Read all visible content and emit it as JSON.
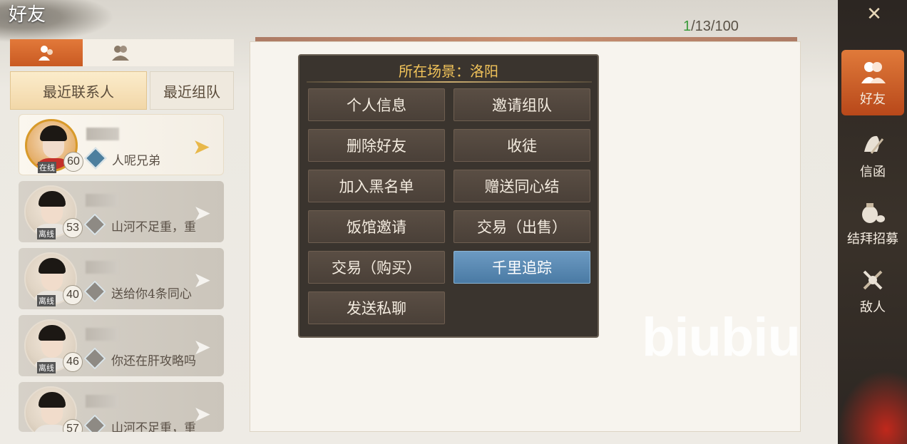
{
  "header": {
    "title": "好友",
    "counter_current": "1",
    "counter_rest": "/13/100"
  },
  "left_tabs": [
    {
      "icon": "friend-icon",
      "active": true
    },
    {
      "icon": "group-icon",
      "active": false
    }
  ],
  "sub_tabs": [
    "最近联系人",
    "最近组队"
  ],
  "contacts": [
    {
      "level": "60",
      "message": "人呢兄弟",
      "status": "在线"
    },
    {
      "level": "53",
      "message": "山河不足重，重",
      "status": "离线"
    },
    {
      "level": "40",
      "message": "送给你4条同心",
      "status": "离线"
    },
    {
      "level": "46",
      "message": "你还在肝攻略吗",
      "status": "离线"
    },
    {
      "level": "57",
      "message": "山河不足重，重",
      "status": ""
    }
  ],
  "menu": {
    "title": "所在场景：洛阳",
    "buttons": [
      "个人信息",
      "邀请组队",
      "删除好友",
      "收徒",
      "加入黑名单",
      "赠送同心结",
      "饭馆邀请",
      "交易（出售）",
      "交易（购买）",
      "千里追踪",
      "发送私聊"
    ],
    "highlighted": "千里追踪"
  },
  "right_nav": [
    "好友",
    "信函",
    "结拜招募",
    "敌人"
  ],
  "watermark": "biubiu",
  "colors": {
    "accent_orange": "#e07a3a",
    "menu_bg": "#3a342e",
    "menu_title": "#f2c45a",
    "highlight_blue": "#5a8ab4"
  }
}
